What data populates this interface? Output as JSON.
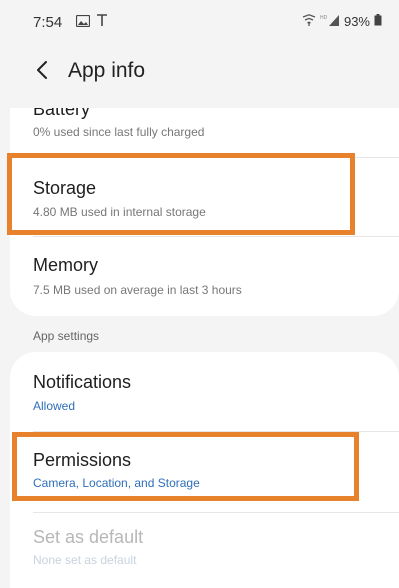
{
  "status_bar": {
    "time": "7:54",
    "left_icons": [
      "image-icon",
      "notification-icon"
    ],
    "right_icons": [
      "wifi-icon",
      "signal-icon"
    ],
    "battery_percent": "93%"
  },
  "app_bar": {
    "title": "App info",
    "back_icon": "chevron-left-icon"
  },
  "details_items": [
    {
      "title": "Battery",
      "subtitle": "0% used since last fully charged"
    },
    {
      "title": "Storage",
      "subtitle": "4.80 MB used in internal storage",
      "highlighted": true
    },
    {
      "title": "Memory",
      "subtitle": "7.5 MB used on average in last 3 hours"
    }
  ],
  "section_label": "App settings",
  "settings_items": [
    {
      "title": "Notifications",
      "subtitle": "Allowed",
      "subtitle_style": "accent"
    },
    {
      "title": "Permissions",
      "subtitle": "Camera, Location, and Storage",
      "subtitle_style": "accent",
      "highlighted": true
    },
    {
      "title": "Set as default",
      "subtitle": "None set as default",
      "disabled": true
    }
  ],
  "colors": {
    "background": "#f4f4f4",
    "card": "#ffffff",
    "accent_text": "#2f6fb8",
    "highlight_border": "#e8812b"
  }
}
